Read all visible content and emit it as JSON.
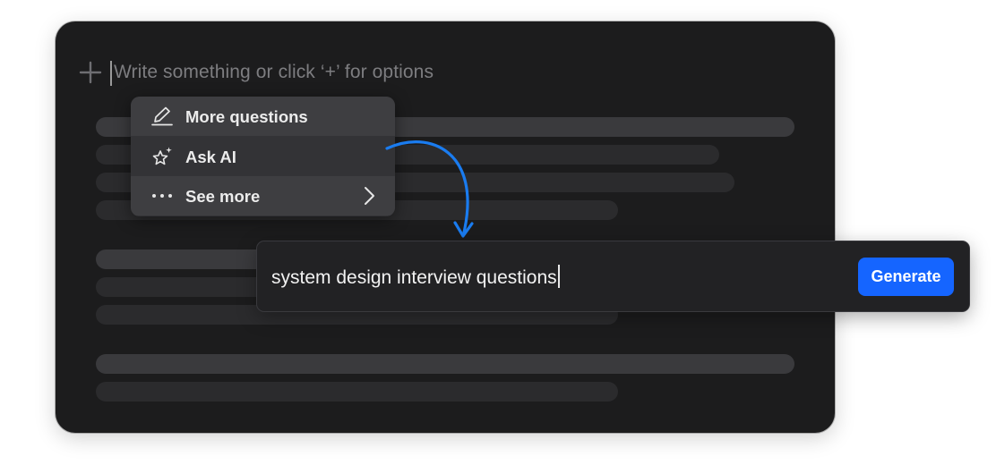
{
  "editor": {
    "placeholder": "Write something or click ‘+’ for options"
  },
  "menu": {
    "items": [
      {
        "label": "More questions",
        "icon": "pencil-icon"
      },
      {
        "label": "Ask AI",
        "icon": "sparkle-star-icon"
      },
      {
        "label": "See more",
        "icon": "more-dots-icon",
        "trailing_icon": "chevron-right-icon"
      }
    ]
  },
  "prompt": {
    "value": "system design interview questions",
    "generate_label": "Generate"
  },
  "colors": {
    "editor_bg": "#1c1c1d",
    "accent_blue": "#1565ff",
    "arrow_blue": "#1a7cf0"
  }
}
